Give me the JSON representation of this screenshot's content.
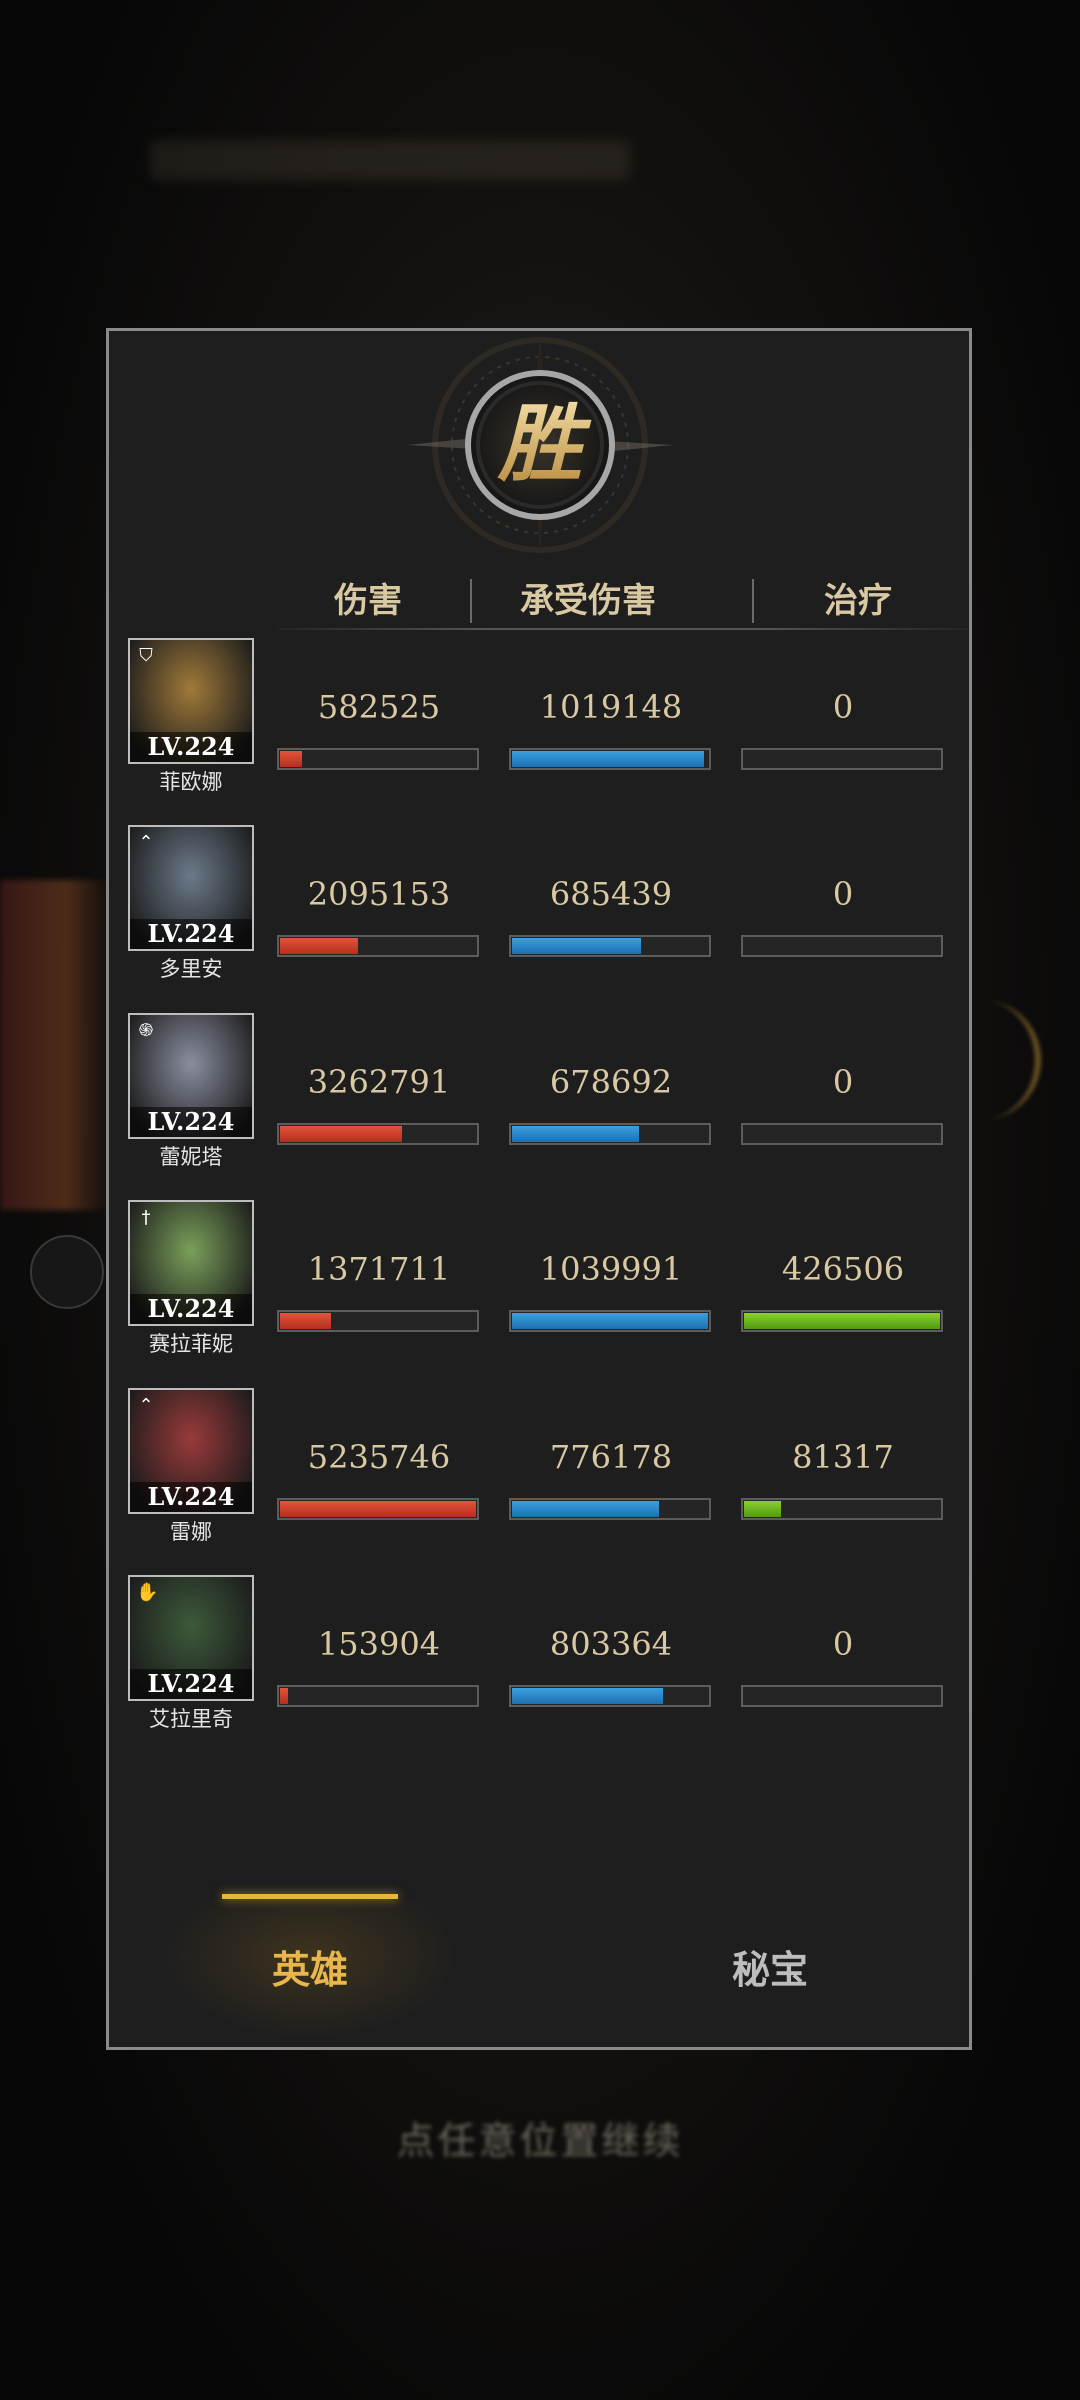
{
  "result": {
    "emblem_text": "胜"
  },
  "columns": {
    "damage": "伤害",
    "damage_taken": "承受伤害",
    "healing": "治疗"
  },
  "heroes": [
    {
      "name": "菲欧娜",
      "level": "LV.224",
      "class_icon": "shield-class-icon",
      "portrait_color": "#a07a3a",
      "damage": "582525",
      "damage_taken": "1019148",
      "healing": "0",
      "damage_ratio": 0.11,
      "damage_taken_ratio": 0.98,
      "healing_ratio": 0
    },
    {
      "name": "多里安",
      "level": "LV.224",
      "class_icon": "bow-class-icon",
      "portrait_color": "#6b7a8a",
      "damage": "2095153",
      "damage_taken": "685439",
      "healing": "0",
      "damage_ratio": 0.4,
      "damage_taken_ratio": 0.66,
      "healing_ratio": 0
    },
    {
      "name": "蕾妮塔",
      "level": "LV.224",
      "class_icon": "spiral-class-icon",
      "portrait_color": "#8a8fa0",
      "damage": "3262791",
      "damage_taken": "678692",
      "healing": "0",
      "damage_ratio": 0.62,
      "damage_taken_ratio": 0.65,
      "healing_ratio": 0
    },
    {
      "name": "赛拉菲妮",
      "level": "LV.224",
      "class_icon": "cross-class-icon",
      "portrait_color": "#7aa05a",
      "damage": "1371711",
      "damage_taken": "1039991",
      "healing": "426506",
      "damage_ratio": 0.26,
      "damage_taken_ratio": 1.0,
      "healing_ratio": 1.0
    },
    {
      "name": "雷娜",
      "level": "LV.224",
      "class_icon": "bow-class-icon",
      "portrait_color": "#9a3a3a",
      "damage": "5235746",
      "damage_taken": "776178",
      "healing": "81317",
      "damage_ratio": 1.0,
      "damage_taken_ratio": 0.75,
      "healing_ratio": 0.19
    },
    {
      "name": "艾拉里奇",
      "level": "LV.224",
      "class_icon": "hand-class-icon",
      "portrait_color": "#3d5a3a",
      "damage": "153904",
      "damage_taken": "803364",
      "healing": "0",
      "damage_ratio": 0.03,
      "damage_taken_ratio": 0.77,
      "healing_ratio": 0
    }
  ],
  "tabs": {
    "heroes": "英雄",
    "treasures": "秘宝"
  },
  "hint": "点任意位置继续"
}
